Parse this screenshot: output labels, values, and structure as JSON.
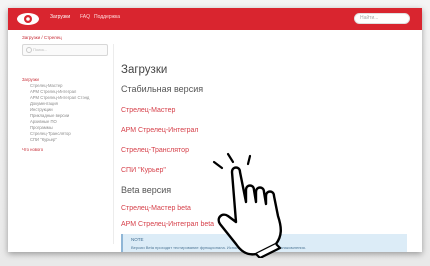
{
  "header": {
    "nav": [
      "Загрузки",
      "FAQ",
      "Поддержка"
    ],
    "search_placeholder": "Найти..."
  },
  "breadcrumb": "Загрузки / Стрелец",
  "sidebar": {
    "search_placeholder": "Поиск...",
    "items": [
      {
        "label": "Загрузки",
        "group": true
      },
      {
        "label": "Стрелец-Мастер"
      },
      {
        "label": "АРМ Стрелец-Интеграл"
      },
      {
        "label": "АРМ Стрелец-Интеграл Стэнд"
      },
      {
        "label": "Документация"
      },
      {
        "label": "Инструкции"
      },
      {
        "label": "Прикладные версии"
      },
      {
        "label": "Архивные ПО"
      },
      {
        "label": "Программы"
      },
      {
        "label": "Стрелец-Транслятор"
      },
      {
        "label": "СПИ \"Курьер\""
      },
      {
        "label": "Что нового",
        "group": true
      }
    ]
  },
  "main": {
    "title": "Загрузки",
    "stable_heading": "Стабильная версия",
    "stable_links": [
      "Стрелец-Мастер",
      "АРМ Стрелец-Интеграл",
      "Стрелец-Транслятор",
      "СПИ \"Курьер\""
    ],
    "beta_heading": "Beta версия",
    "beta_links": [
      "Стрелец-Мастер beta",
      "АРМ Стрелец-Интеграл beta"
    ],
    "note": {
      "title": "NOTE",
      "text": "Версии Beta проходят тестирование функционала. Используйте их только для ознакомления."
    }
  },
  "colors": {
    "brand": "#d9252f",
    "link": "#d6404a"
  }
}
